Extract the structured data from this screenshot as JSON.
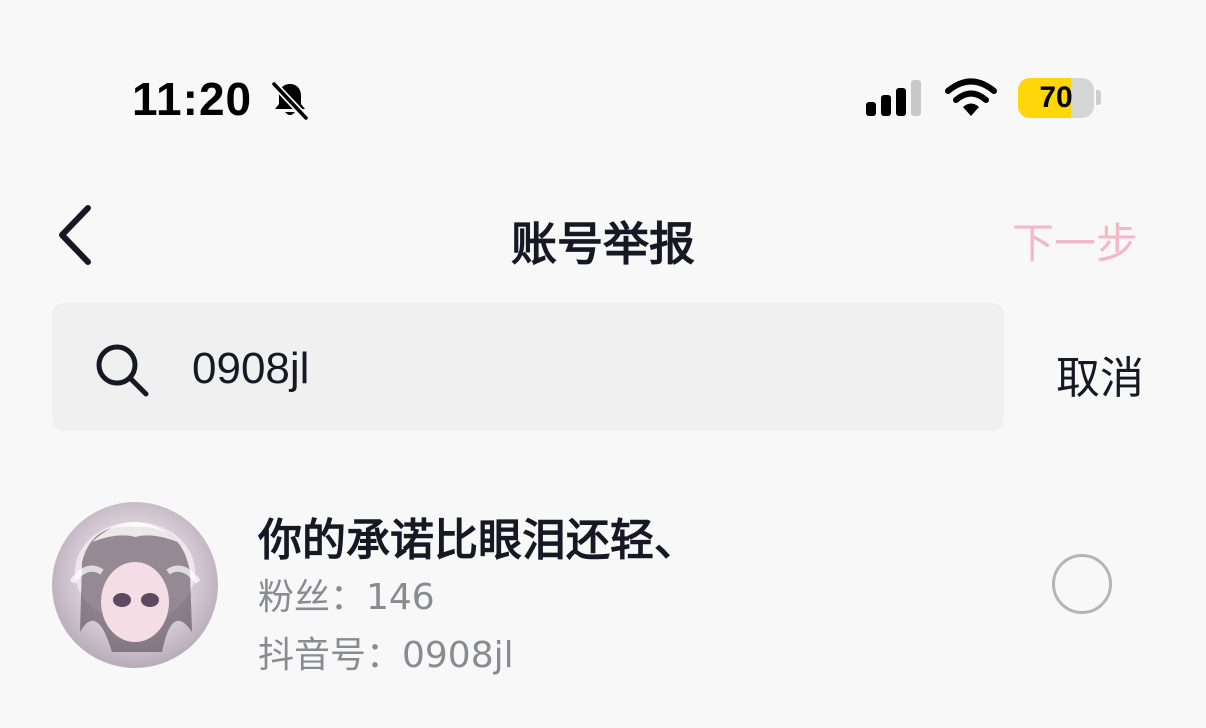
{
  "status_bar": {
    "time": "11:20",
    "battery_level": 70,
    "battery_text": "70",
    "battery_color": "#ffd60a",
    "icons": [
      "bell-muted-icon",
      "signal-icon",
      "wifi-icon",
      "battery-icon"
    ]
  },
  "nav": {
    "title": "账号举报",
    "next_label": "下一步",
    "next_color": "#f4b8c6",
    "back_icon": "chevron-left-icon"
  },
  "search": {
    "value": "0908jl",
    "icon": "search-icon",
    "cancel_label": "取消"
  },
  "results": [
    {
      "name": "你的承诺比眼泪还轻、",
      "fans_label": "粉丝：",
      "fans_count": "146",
      "fans_text": "粉丝：146",
      "id_label": "抖音号：",
      "id_value": "0908jl",
      "id_text": "抖音号：0908jl",
      "selected": false
    }
  ]
}
